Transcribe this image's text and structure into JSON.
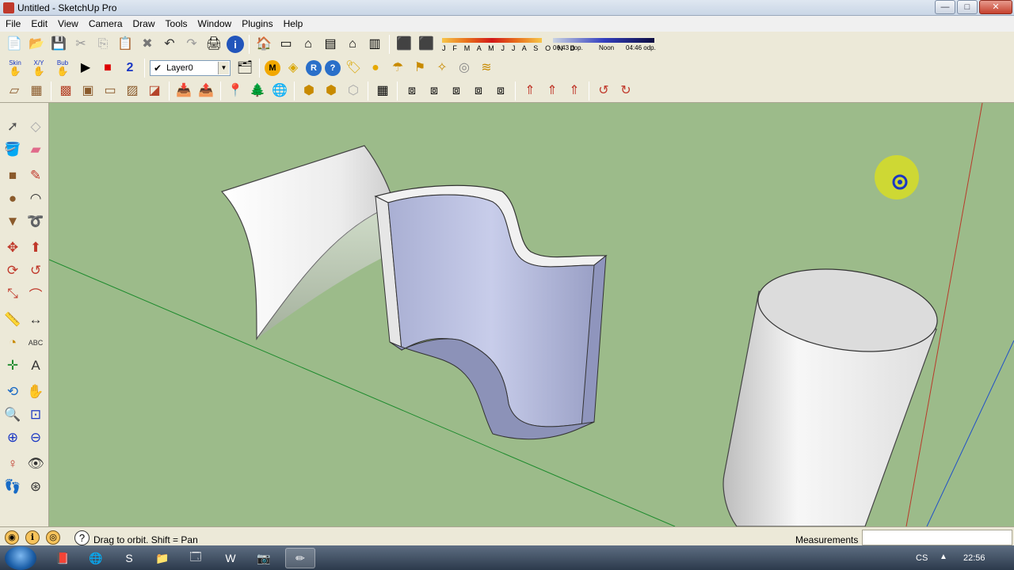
{
  "window": {
    "title": "Untitled - SketchUp Pro",
    "minimize": "—",
    "maximize": "□",
    "close": "✕"
  },
  "menu": [
    "File",
    "Edit",
    "View",
    "Camera",
    "Draw",
    "Tools",
    "Window",
    "Plugins",
    "Help"
  ],
  "toolbar": {
    "layer": {
      "selected": "Layer0",
      "checked": "✔"
    },
    "shadows": {
      "months": "J F M A M J J A S O N D",
      "time_start": "06:43 dop.",
      "time_mid": "Noon",
      "time_end": "04:46 odp."
    },
    "plugin_labels": [
      "Skin",
      "X/Y",
      "Bub"
    ]
  },
  "status": {
    "hint": "Drag to orbit.  Shift = Pan",
    "measurements_label": "Measurements",
    "measurements_value": ""
  },
  "taskbar": {
    "language": "CS",
    "clock": "22:56",
    "tray_arrow": "▲"
  },
  "colors": {
    "viewport_bg": "#9cbb8a",
    "face_front": "#f2f2f2",
    "face_back": "#b9c0dd",
    "axis_red": "#b83a2a",
    "axis_green": "#1c8a2c",
    "axis_blue": "#2050c8",
    "orbit_cursor": "#d7dd24"
  }
}
